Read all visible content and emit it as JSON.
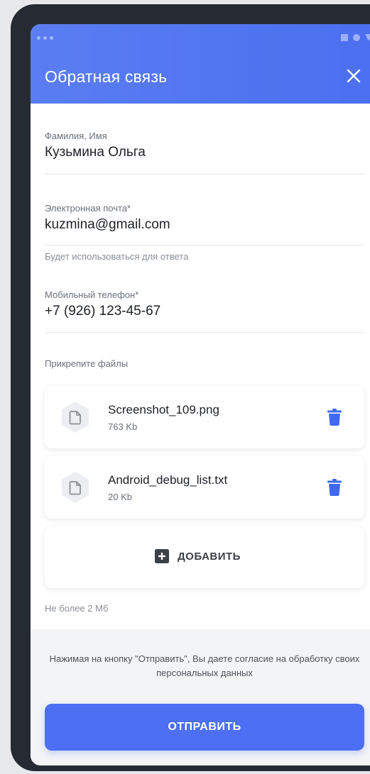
{
  "header": {
    "title": "Обратная связь",
    "close_icon": "close-icon"
  },
  "form": {
    "name": {
      "label": "Фамилия, Имя",
      "value": "Кузьмина Ольга"
    },
    "email": {
      "label": "Электронная почта*",
      "value": "kuzmina@gmail.com",
      "hint": "Будет использоваться для ответа"
    },
    "phone": {
      "label": "Мобильный телефон*",
      "value": "+7 (926) 123-45-67"
    },
    "attachments": {
      "label": "Прикрепите файлы",
      "files": [
        {
          "name": "Screenshot_109.png",
          "size": "763 Kb",
          "icon": "file-icon",
          "delete_icon": "trash-icon"
        },
        {
          "name": "Android_debug_list.txt",
          "size": "20 Kb",
          "icon": "file-icon",
          "delete_icon": "trash-icon"
        }
      ],
      "add_label": "ДОБАВИТЬ",
      "limit": "Не более 2 Мб"
    }
  },
  "footer": {
    "consent": "Нажимая на кнопку \"Отправить\", Вы даете согласие на обработку своих персональных данных",
    "submit_label": "ОТПРАВИТЬ"
  },
  "colors": {
    "accent": "#4c6ff3",
    "header": "#5a7df2",
    "trash": "#3f6af0",
    "frame": "#262b33"
  }
}
